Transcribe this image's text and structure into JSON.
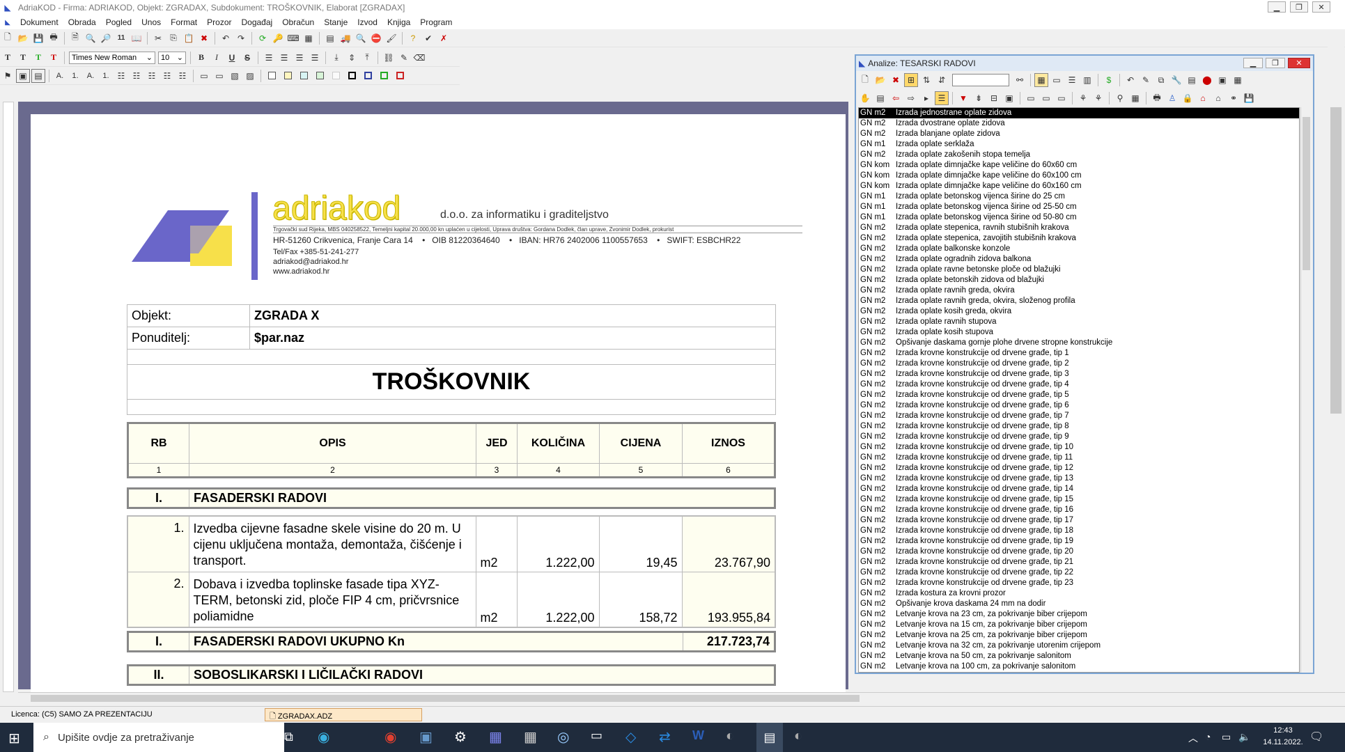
{
  "window": {
    "title": "AdriaKOD - Firma: ADRIAKOD,  Objekt: ZGRADAX,  Subdokument: TROŠKOVNIK,  Elaborat [ZGRADAX]"
  },
  "menu": [
    "Dokument",
    "Obrada",
    "Pogled",
    "Unos",
    "Format",
    "Prozor",
    "Događaj",
    "Obračun",
    "Stanje",
    "Izvod",
    "Knjiga",
    "Program"
  ],
  "format_toolbar": {
    "font": "Times New Roman",
    "size": "10",
    "text_buttons": [
      "T",
      "T",
      "T",
      "T"
    ]
  },
  "company": {
    "name": "adriakod",
    "subtitle": "d.o.o. za informatiku i graditeljstvo",
    "reg": "Trgovački sud Rijeka,  MBS 040258522,  Temeljni kapital 20.000,00 kn uplaćen u cijelosti,  Uprava društva: Gordana Dodlek, član uprave, Zvonimir Dodlek, prokurist",
    "address": "HR-51260 Crikvenica, Franje Cara 14    •   OIB 81220364640    •   IBAN: HR76 2402006 1100557653    •   SWIFT: ESBCHR22",
    "tel": "Tel/Fax +385-51-241-277",
    "email": "adriakod@adriakod.hr",
    "web": "www.adriakod.hr",
    "brand_color": "#6a66c9",
    "accent_color": "#f7e04a"
  },
  "doc": {
    "objekt_label": "Objekt:",
    "objekt_value": "ZGRADA X",
    "ponuditelj_label": "Ponuditelj:",
    "ponuditelj_value": "$par.naz",
    "title": "TROŠKOVNIK",
    "columns": [
      "RB",
      "OPIS",
      "JED",
      "KOLIČINA",
      "CIJENA",
      "IZNOS"
    ],
    "col_numbers": [
      "1",
      "2",
      "3",
      "4",
      "5",
      "6"
    ],
    "section1": {
      "rb": "I.",
      "name": "FASADERSKI RADOVI"
    },
    "items": [
      {
        "rb": "1.",
        "opis": "Izvedba cijevne fasadne skele visine do 20 m. U cijenu uključena montaža, demontaža, čišćenje i transport.",
        "jed": "m2",
        "kol": "1.222,00",
        "cijena": "19,45",
        "iznos": "23.767,90"
      },
      {
        "rb": "2.",
        "opis": "Dobava i izvedba toplinske fasade tipa XYZ-TERM, betonski zid, ploče FIP 4 cm, pričvrsnice poliamidne",
        "jed": "m2",
        "kol": "1.222,00",
        "cijena": "158,72",
        "iznos": "193.955,84"
      }
    ],
    "total1": {
      "rb": "I.",
      "name": "FASADERSKI RADOVI UKUPNO Kn",
      "value": "217.723,74"
    },
    "section2": {
      "rb": "II.",
      "name": "SOBOSLIKARSKI I LIČILAČKI RADOVI"
    }
  },
  "analiza": {
    "title": "Analize: TESARSKI RADOVI",
    "rows": [
      [
        "GN m2",
        "Izrada jednostrane oplate zidova"
      ],
      [
        "GN m2",
        "Izrada dvostrane oplate zidova"
      ],
      [
        "GN m2",
        "Izrada blanjane oplate zidova"
      ],
      [
        "GN m1",
        "Izrada oplate serklaža"
      ],
      [
        "GN m2",
        "Izrada oplate zakošenih stopa temelja"
      ],
      [
        "GN kom",
        "Izrada oplate dimnjačke kape veličine do 60x60 cm"
      ],
      [
        "GN kom",
        "Izrada oplate dimnjačke kape veličine do 60x100 cm"
      ],
      [
        "GN kom",
        "Izrada oplate dimnjačke kape veličine do 60x160 cm"
      ],
      [
        "GN m1",
        "Izrada oplate betonskog vijenca širine do 25 cm"
      ],
      [
        "GN m1",
        "Izrada oplate betonskog vijenca širine od 25-50 cm"
      ],
      [
        "GN m1",
        "Izrada oplate betonskog vijenca širine od 50-80 cm"
      ],
      [
        "GN m2",
        "Izrada oplate stepenica, ravnih stubišnih krakova"
      ],
      [
        "GN m2",
        "Izrada oplate stepenica, zavojitih stubišnih krakova"
      ],
      [
        "GN m2",
        "Izrada oplate balkonske konzole"
      ],
      [
        "GN m2",
        "Izrada oplate ogradnih zidova balkona"
      ],
      [
        "GN m2",
        "Izrada oplate ravne betonske ploče od blažujki"
      ],
      [
        "GN m2",
        "Izrada oplate betonskih zidova od blažujki"
      ],
      [
        "GN m2",
        "Izrada oplate ravnih greda, okvira"
      ],
      [
        "GN m2",
        "Izrada oplate ravnih greda, okvira, složenog profila"
      ],
      [
        "GN m2",
        "Izrada oplate kosih greda, okvira"
      ],
      [
        "GN m2",
        "Izrada oplate ravnih stupova"
      ],
      [
        "GN m2",
        "Izrada oplate kosih stupova"
      ],
      [
        "GN m2",
        "Opšivanje daskama gornje plohe drvene stropne konstrukcije"
      ],
      [
        "GN m2",
        "Izrada krovne konstrukcije od drvene građe, tip 1"
      ],
      [
        "GN m2",
        "Izrada krovne konstrukcije od drvene građe, tip 2"
      ],
      [
        "GN m2",
        "Izrada krovne konstrukcije od drvene građe, tip 3"
      ],
      [
        "GN m2",
        "Izrada krovne konstrukcije od drvene građe, tip 4"
      ],
      [
        "GN m2",
        "Izrada krovne konstrukcije od drvene građe, tip 5"
      ],
      [
        "GN m2",
        "Izrada krovne konstrukcije od drvene građe, tip 6"
      ],
      [
        "GN m2",
        "Izrada krovne konstrukcije od drvene građe, tip 7"
      ],
      [
        "GN m2",
        "Izrada krovne konstrukcije od drvene građe, tip 8"
      ],
      [
        "GN m2",
        "Izrada krovne konstrukcije od drvene građe, tip 9"
      ],
      [
        "GN m2",
        "Izrada krovne konstrukcije od drvene građe, tip 10"
      ],
      [
        "GN m2",
        "Izrada krovne konstrukcije od drvene građe, tip 11"
      ],
      [
        "GN m2",
        "Izrada krovne konstrukcije od drvene građe, tip 12"
      ],
      [
        "GN m2",
        "Izrada krovne konstrukcije od drvene građe, tip 13"
      ],
      [
        "GN m2",
        "Izrada krovne konstrukcije od drvene građe, tip 14"
      ],
      [
        "GN m2",
        "Izrada krovne konstrukcije od drvene građe, tip 15"
      ],
      [
        "GN m2",
        "Izrada krovne konstrukcije od drvene građe, tip 16"
      ],
      [
        "GN m2",
        "Izrada krovne konstrukcije od drvene građe, tip 17"
      ],
      [
        "GN m2",
        "Izrada krovne konstrukcije od drvene građe, tip 18"
      ],
      [
        "GN m2",
        "Izrada krovne konstrukcije od drvene građe, tip 19"
      ],
      [
        "GN m2",
        "Izrada krovne konstrukcije od drvene građe, tip 20"
      ],
      [
        "GN m2",
        "Izrada krovne konstrukcije od drvene građe, tip 21"
      ],
      [
        "GN m2",
        "Izrada krovne konstrukcije od drvene građe, tip 22"
      ],
      [
        "GN m2",
        "Izrada krovne konstrukcije od drvene građe, tip 23"
      ],
      [
        "GN m2",
        "Izrada kostura za krovni prozor"
      ],
      [
        "GN m2",
        "Opšivanje krova daskama 24 mm na dodir"
      ],
      [
        "GN m2",
        "Letvanje krova na 23 cm, za pokrivanje biber crijepom"
      ],
      [
        "GN m2",
        "Letvanje krova na 15 cm, za pokrivanje biber crijepom"
      ],
      [
        "GN m2",
        "Letvanje krova na 25 cm, za pokrivanje biber crijepom"
      ],
      [
        "GN m2",
        "Letvanje krova na 32 cm, za pokrivanje utorenim crijepom"
      ],
      [
        "GN m2",
        "Letvanje krova na 50 cm, za pokrivanje salonitom"
      ],
      [
        "GN m2",
        "Letvanje krova na 100 cm, za pokrivanje salonitom"
      ]
    ]
  },
  "status": {
    "licence": "Licenca:  (C5) SAMO ZA PREZENTACIJU",
    "file": "ZGRADAX.ADZ"
  },
  "taskbar": {
    "search_placeholder": "Upišite ovdje za pretraživanje",
    "time": "12:43",
    "date": "14.11.2022."
  }
}
